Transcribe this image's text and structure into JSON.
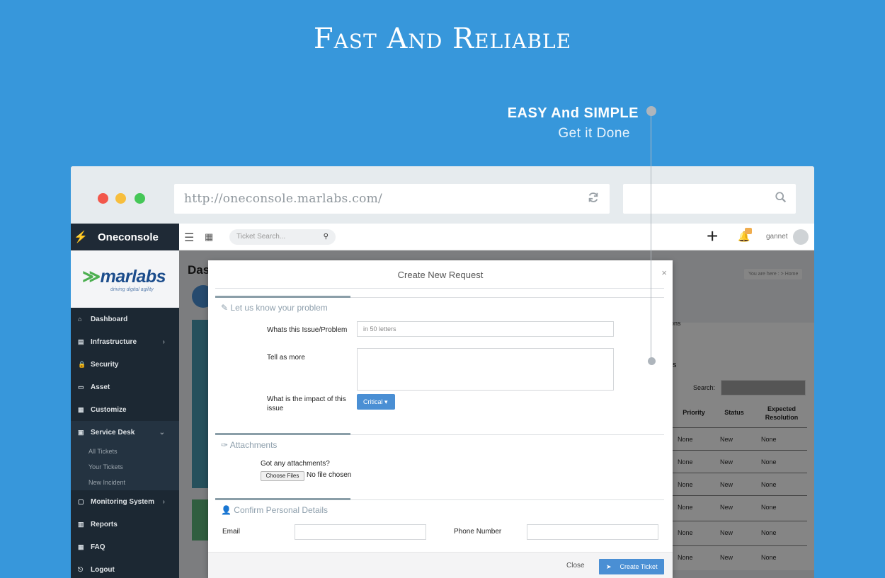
{
  "hero": {
    "title": "Fast And Reliable"
  },
  "callout": {
    "title": "EASY And SIMPLE",
    "subtitle": "Get it Done"
  },
  "browser": {
    "url": "http://oneconsole.marlabs.com/"
  },
  "app": {
    "brand": "Oneconsole",
    "ticket_search_placeholder": "Ticket Search...",
    "user_name": "gannet",
    "logo_text": "marlabs",
    "logo_tagline": "driving digital agility",
    "page_title": "Das",
    "breadcrumb": "You are here : > Home"
  },
  "sidebar": {
    "items": [
      {
        "label": "Dashboard",
        "icon": "home-icon"
      },
      {
        "label": "Infrastructure",
        "icon": "server-icon",
        "has_caret": true
      },
      {
        "label": "Security",
        "icon": "lock-icon"
      },
      {
        "label": "Asset",
        "icon": "laptop-icon"
      },
      {
        "label": "Customize",
        "icon": "grid-icon"
      },
      {
        "label": "Service Desk",
        "icon": "briefcase-icon",
        "has_caret": true
      },
      {
        "label": "Monitoring System",
        "icon": "monitor-icon",
        "has_caret": true
      },
      {
        "label": "Reports",
        "icon": "chart-icon"
      },
      {
        "label": "FAQ",
        "icon": "calendar-icon"
      },
      {
        "label": "Logout",
        "icon": "logout-icon"
      }
    ],
    "service_desk_subitems": [
      "All Tickets",
      "Your Tickets",
      "New Incident"
    ]
  },
  "background_table": {
    "partial_heading_1": "ons",
    "partial_heading_2": "s",
    "search_label": "Search:",
    "columns": [
      "Priority",
      "Status",
      "Expected Resolution"
    ],
    "rows": [
      [
        "None",
        "New",
        "None"
      ],
      [
        "None",
        "New",
        "None"
      ],
      [
        "None",
        "New",
        "None"
      ],
      [
        "None",
        "New",
        "None"
      ],
      [
        "None",
        "New",
        "None"
      ],
      [
        "None",
        "New",
        "None"
      ]
    ]
  },
  "modal": {
    "title": "Create New Request",
    "close_symbol": "×",
    "section_problem": "Let us know your problem",
    "issue_label": "Whats this Issue/Problem",
    "issue_placeholder": "in 50 letters",
    "tell_more_label": "Tell as more",
    "impact_label": "What is the impact of this issue",
    "impact_value": "Critical",
    "section_attachments": "Attachments",
    "attachments_question": "Got any attachments?",
    "choose_files": "Choose Files",
    "no_file": "No file chosen",
    "section_personal": "Confirm Personal Details",
    "email_label": "Email",
    "phone_label": "Phone Number",
    "close_button": "Close",
    "create_button": "Create Ticket"
  }
}
